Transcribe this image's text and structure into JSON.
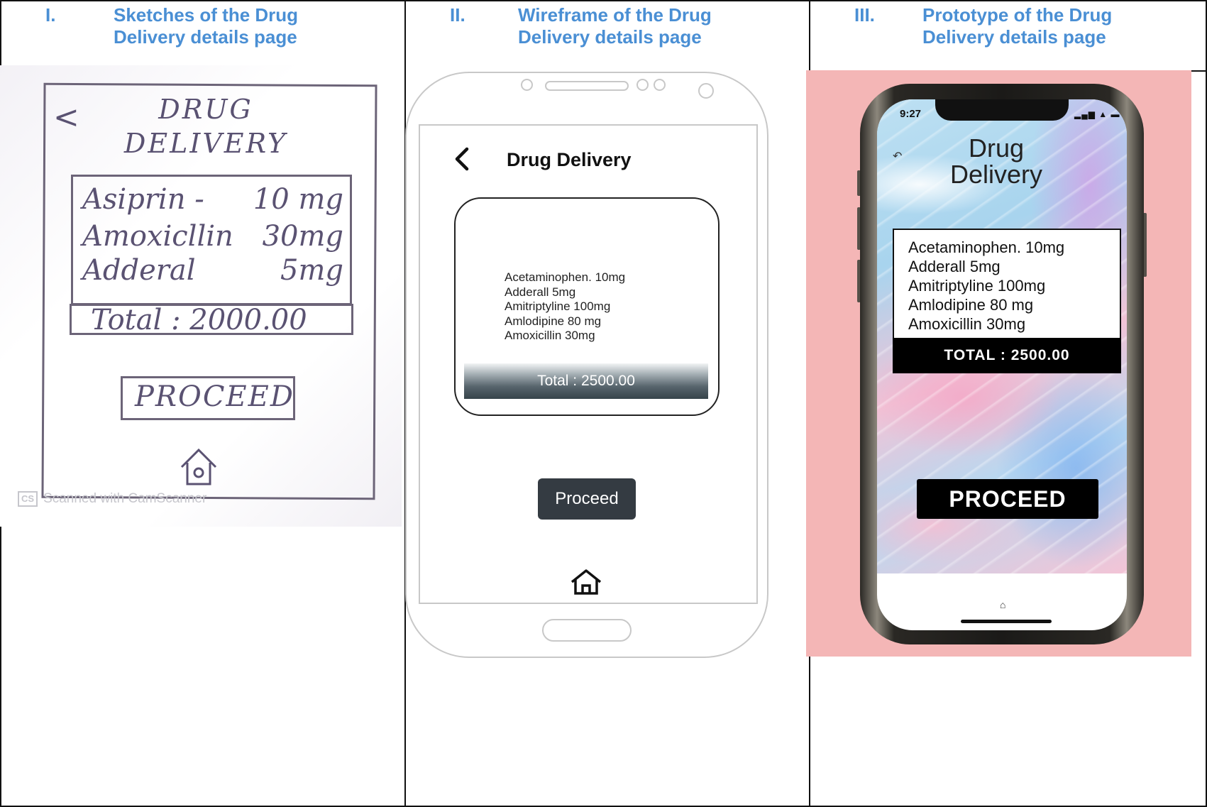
{
  "columns": [
    {
      "numeral": "I.",
      "title": "Sketches of the Drug Delivery details page"
    },
    {
      "numeral": "II.",
      "title": "Wireframe of the Drug Delivery details page"
    },
    {
      "numeral": "III.",
      "title": "Prototype of the Drug Delivery details page"
    }
  ],
  "sketch": {
    "back": "<",
    "title_line1": "DRUG",
    "title_line2": "DELIVERY",
    "items": [
      {
        "name": "Asiprin -",
        "dose": "10 mg"
      },
      {
        "name": "Amoxicllin",
        "dose": "30mg"
      },
      {
        "name": "Adderal",
        "dose": "5mg"
      }
    ],
    "total": "Total : 2000.00",
    "proceed": "PROCEED",
    "watermark": "Scanned with CamScanner",
    "watermark_logo": "CS"
  },
  "wireframe": {
    "title": "Drug Delivery",
    "medications": [
      "Acetaminophen. 10mg",
      "Adderall 5mg",
      "Amitriptyline 100mg",
      "Amlodipine 80 mg",
      "Amoxicillin 30mg"
    ],
    "total": "Total : 2500.00",
    "proceed": "Proceed"
  },
  "prototype": {
    "time": "9:27",
    "status": "▂▄▆ ▲ ▬",
    "back": "↶",
    "title_line1": "Drug",
    "title_line2": "Delivery",
    "medications": [
      "Acetaminophen. 10mg",
      "Adderall 5mg",
      "Amitriptyline 100mg",
      "Amlodipine 80 mg",
      "Amoxicillin 30mg"
    ],
    "total": "TOTAL : 2500.00",
    "proceed": "PROCEED",
    "home": "⌂"
  },
  "colors": {
    "heading": "#4a8fd4",
    "prototype_background": "#f4b6b6",
    "wireframe_button": "#343b42"
  }
}
